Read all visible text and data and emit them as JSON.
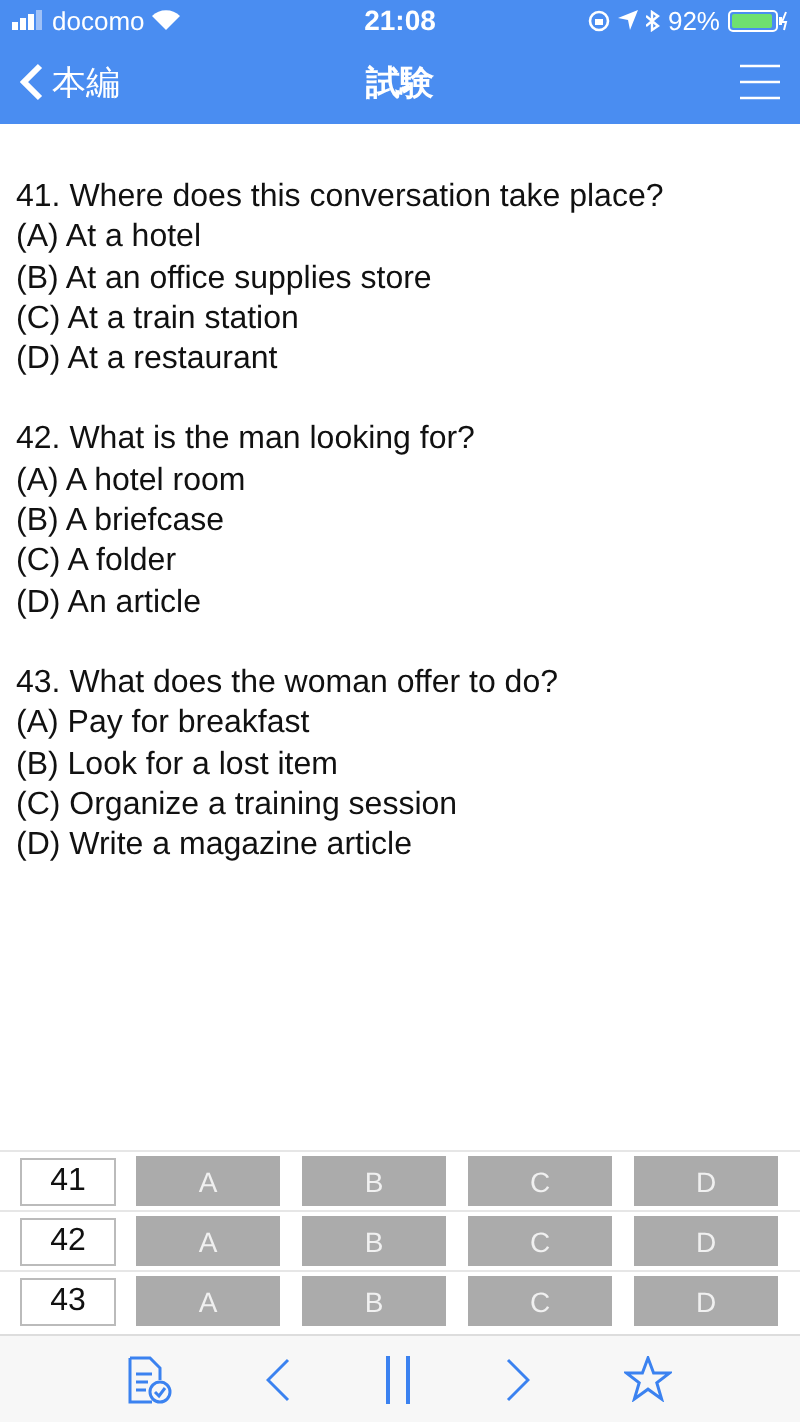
{
  "status_bar": {
    "carrier": "docomo",
    "time": "21:08",
    "battery": "92%"
  },
  "nav_bar": {
    "back": "本編",
    "title": "試験"
  },
  "questions": [
    {
      "text": "41. Where does this conversation take place?",
      "options": [
        "(A) At a hotel",
        "(B) At an office supplies store",
        "(C) At a train station",
        "(D) At a restaurant"
      ]
    },
    {
      "text": "42. What is the man looking for?",
      "options": [
        "(A) A hotel room",
        "(B) A briefcase",
        "(C) A folder",
        "(D) An article"
      ]
    },
    {
      "text": "43. What does the woman offer to do?",
      "options": [
        "(A) Pay for breakfast",
        "(B) Look for a lost item",
        "(C) Organize a training session",
        "(D) Write a magazine article"
      ]
    }
  ],
  "answer_sheet": [
    {
      "number": "41",
      "choices": [
        {
          "label": "A",
          "selected": false
        },
        {
          "label": "B",
          "selected": false
        },
        {
          "label": "C",
          "selected": false
        },
        {
          "label": "D",
          "selected": false
        }
      ]
    },
    {
      "number": "42",
      "choices": [
        {
          "label": "A",
          "selected": false
        },
        {
          "label": "B",
          "selected": false
        },
        {
          "label": "C",
          "selected": false
        },
        {
          "label": "D",
          "selected": false
        }
      ]
    },
    {
      "number": "43",
      "choices": [
        {
          "label": "A",
          "selected": false
        },
        {
          "label": "B",
          "selected": false
        },
        {
          "label": "C",
          "selected": false
        },
        {
          "label": "D",
          "selected": false
        }
      ]
    }
  ]
}
